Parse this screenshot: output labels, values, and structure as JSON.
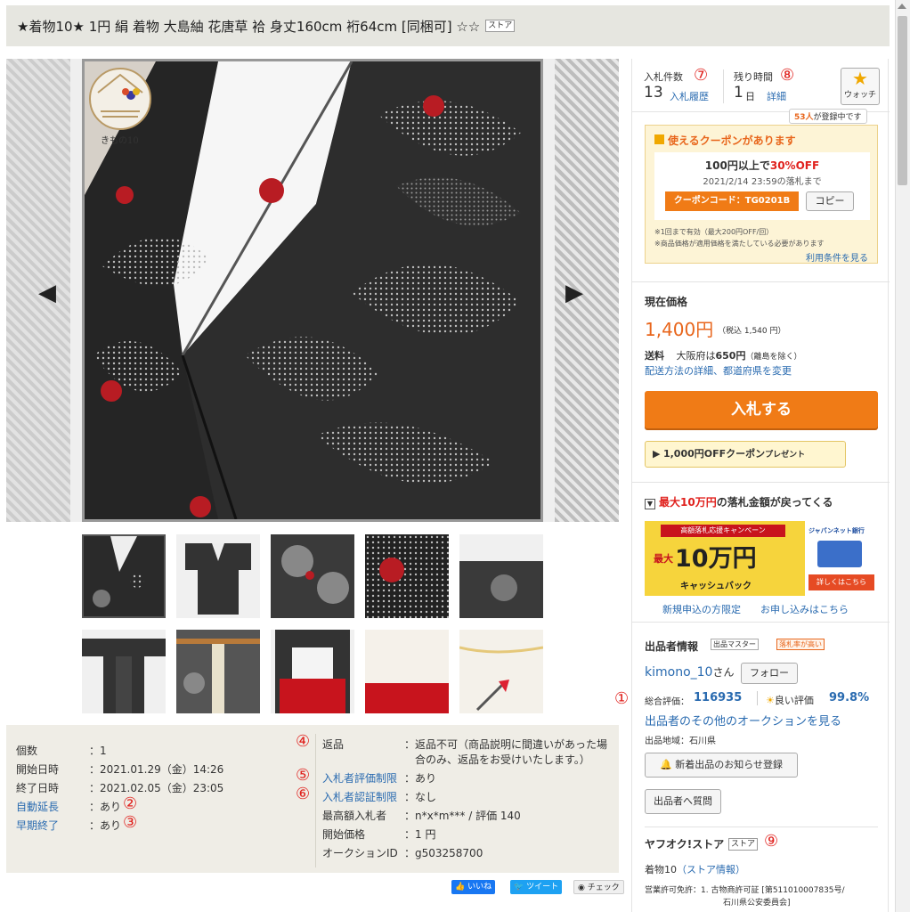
{
  "title": {
    "text": "★着物10★ 1円 絹 着物 大島紬 花唐草 袷 身丈160cm 裄64cm [同梱可] ☆☆",
    "store_tag": "ストア"
  },
  "logo": {
    "text": "きもの10"
  },
  "info": {
    "left": [
      {
        "label": "個数",
        "value": "：1",
        "link": false,
        "mark": ""
      },
      {
        "label": "開始日時",
        "value": "：2021.01.29（金）14:26",
        "link": false,
        "mark": ""
      },
      {
        "label": "終了日時",
        "value": "：2021.02.05（金）23:05",
        "link": false,
        "mark": ""
      },
      {
        "label": "自動延長",
        "value": "：あり",
        "link": true,
        "mark": "②"
      },
      {
        "label": "早期終了",
        "value": "：あり",
        "link": true,
        "mark": "③"
      }
    ],
    "right": [
      {
        "label": "返品",
        "value": "：返品不可（商品説明に間違いがあった場",
        "value2": "合のみ、返品をお受けいたします。）",
        "link": false,
        "mark": "④"
      },
      {
        "label": "入札者評価制限",
        "value": "：あり",
        "link": true,
        "mark": "⑤"
      },
      {
        "label": "入札者認証制限",
        "value": "：なし",
        "link": true,
        "mark": "⑥"
      },
      {
        "label": "最高額入札者",
        "value": "：n*x*m*** / 評価 140",
        "link": false,
        "mark": ""
      },
      {
        "label": "開始価格",
        "value": "：1 円",
        "link": false,
        "mark": ""
      },
      {
        "label": "オークションID",
        "value": "：g503258700",
        "link": false,
        "mark": ""
      }
    ]
  },
  "social": {
    "like": "いいね",
    "tweet": "ツイート",
    "check": "チェック"
  },
  "bids": {
    "label": "入札件数",
    "mark": "⑦",
    "count": "13",
    "history": "入札履歴"
  },
  "time": {
    "label": "残り時間",
    "mark": "⑧",
    "value": "1",
    "unit": "日",
    "detail": "詳細"
  },
  "watch": {
    "label": "ウォッチ",
    "count_text": "53人",
    "suffix": "が登録中です"
  },
  "coupon": {
    "head": "使えるクーポンがあります",
    "line1a": "100円以上で",
    "line1b": "30%OFF",
    "line2": "2021/2/14 23:59の落札まで",
    "code": "クーポンコード：TG0201B",
    "copy": "コピー",
    "note1": "※1回まで有効（最大200円OFF/回）",
    "note2": "※商品価格が適用価格を満たしている必要があります",
    "terms": "利用条件を見る"
  },
  "price": {
    "label": "現在価格",
    "value": "1,400円",
    "tax": "（税込 1,540 円）",
    "ship_label": "送料",
    "ship_text": "大阪府は",
    "ship_price": "650円",
    "ship_note": "（離島を除く）",
    "ship_link": "配送方法の詳細、都道府県を変更"
  },
  "bid_button": "入札する",
  "present": {
    "highlight": "1,000円OFFクーポン",
    "suffix": "プレゼント"
  },
  "cashback": {
    "head_red": "最大10万円",
    "head_rest": "の落札金額が戻ってくる",
    "b_top": "高額落札応援キャンペーン",
    "b_max": "最大",
    "b_big": "10万円",
    "b_sub": "キャッシュバック",
    "bank": "ジャパンネット銀行",
    "detail": "詳しくはこちら",
    "link1": "新規申込の方限定",
    "link2": "お申し込みはこちら"
  },
  "seller": {
    "head": "出品者情報",
    "badge1": "出品マスター",
    "badge2": "落札率が高い",
    "name": "kimono_10",
    "san": "さん",
    "follow": "フォロー",
    "mark1": "①",
    "rating_label": "総合評価：",
    "rating": "116935",
    "good_label": "良い評価",
    "good": "99.8%",
    "other": "出品者のその他のオークションを見る",
    "region": "出品地域：石川県",
    "notify": "新着出品のお知らせ登録",
    "ask": "出品者へ質問"
  },
  "store": {
    "head": "ヤフオク!ストア",
    "tag": "ストア",
    "mark": "⑨",
    "name": "着物10",
    "info": "（ストア情報）",
    "license": "営業許可免許：1. 古物商許可証 [第511010007835号/",
    "license2": "石川県公安委員会]"
  },
  "colors": {
    "accent": "#f07b16",
    "link": "#2a6bb0",
    "price": "#e8661c",
    "mark": "#e0211d"
  }
}
